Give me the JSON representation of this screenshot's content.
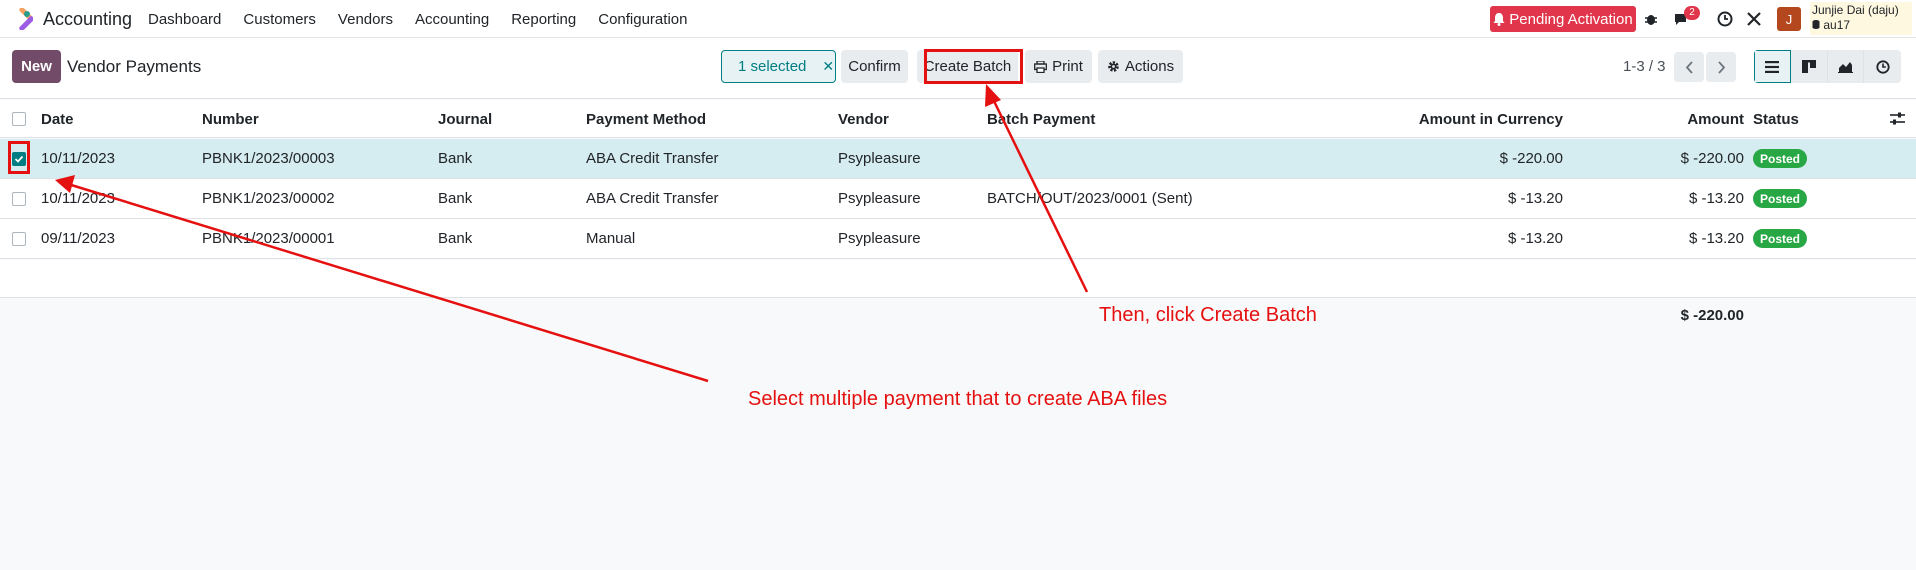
{
  "navbar": {
    "app_name": "Accounting",
    "menu": [
      "Dashboard",
      "Customers",
      "Vendors",
      "Accounting",
      "Reporting",
      "Configuration"
    ],
    "pending_label": "Pending Activation",
    "chat_count": "2",
    "avatar_letter": "J",
    "user_name": "Junjie Dai (daju)",
    "user_db": "au17"
  },
  "control": {
    "new_label": "New",
    "title": "Vendor Payments",
    "selected_label": "1 selected",
    "confirm_label": "Confirm",
    "create_batch_label": "Create Batch",
    "print_label": "Print",
    "actions_label": "Actions",
    "pager": "1-3 / 3"
  },
  "table": {
    "headers": {
      "date": "Date",
      "number": "Number",
      "journal": "Journal",
      "method": "Payment Method",
      "vendor": "Vendor",
      "batch": "Batch Payment",
      "amount_currency": "Amount in Currency",
      "amount": "Amount",
      "status": "Status"
    },
    "rows": [
      {
        "date": "10/11/2023",
        "number": "PBNK1/2023/00003",
        "journal": "Bank",
        "method": "ABA Credit Transfer",
        "vendor": "Psypleasure",
        "batch": "",
        "amount_currency": "$ -220.00",
        "amount": "$ -220.00",
        "status": "Posted",
        "selected": true
      },
      {
        "date": "10/11/2023",
        "number": "PBNK1/2023/00002",
        "journal": "Bank",
        "method": "ABA Credit Transfer",
        "vendor": "Psypleasure",
        "batch": "BATCH/OUT/2023/0001 (Sent)",
        "amount_currency": "$ -13.20",
        "amount": "$ -13.20",
        "status": "Posted",
        "selected": false
      },
      {
        "date": "09/11/2023",
        "number": "PBNK1/2023/00001",
        "journal": "Bank",
        "method": "Manual",
        "vendor": "Psypleasure",
        "batch": "",
        "amount_currency": "$ -13.20",
        "amount": "$ -13.20",
        "status": "Posted",
        "selected": false
      }
    ],
    "total": "$ -220.00"
  },
  "annotations": {
    "step2": "Then, click Create Batch",
    "step1": "Select multiple payment that to create ABA files"
  },
  "colors": {
    "brand": "#714b67",
    "accent": "#017e84",
    "annotation": "#e51010",
    "status_posted": "#28a745"
  }
}
